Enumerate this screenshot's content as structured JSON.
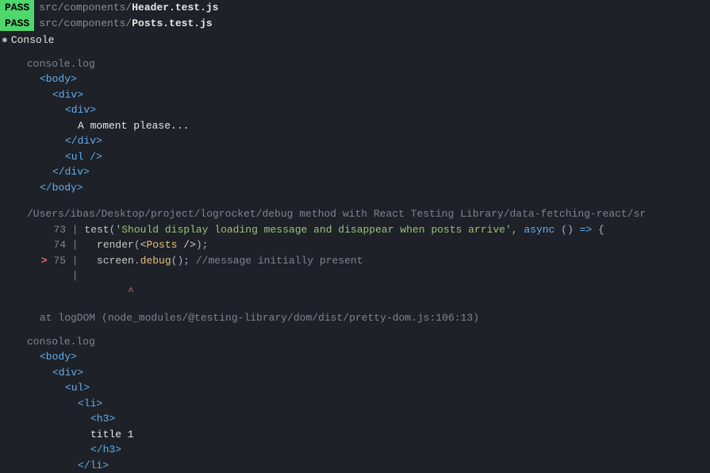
{
  "results": [
    {
      "badge": "PASS",
      "dir": "src/components/",
      "file": "Header.test.js"
    },
    {
      "badge": "PASS",
      "dir": "src/components/",
      "file": "Posts.test.js"
    }
  ],
  "console_label": "Console",
  "log1": {
    "label": "console.log",
    "lines": [
      {
        "cls": "indent-0 tag",
        "text": "<body>"
      },
      {
        "cls": "indent-1 tag",
        "text": "<div>"
      },
      {
        "cls": "indent-2 tag",
        "text": "<div>"
      },
      {
        "cls": "indent-3 text-white",
        "text": "A moment please..."
      },
      {
        "cls": "indent-2 tag",
        "text": "</div>"
      },
      {
        "cls": "indent-2 tag",
        "text": "<ul />"
      },
      {
        "cls": "indent-1 tag",
        "text": "</div>"
      },
      {
        "cls": "indent-0 tag",
        "text": "</body>"
      }
    ]
  },
  "source_path": "/Users/ibas/Desktop/project/logrocket/debug method with React Testing Library/data-fetching-react/sr",
  "code": {
    "line73": {
      "num": "   73 | ",
      "test": "test",
      "paren_open": "(",
      "str": "'Should display loading message and disappear when posts arrive'",
      "comma": ", ",
      "async": "async",
      "arrow": " () ",
      "fat": "=>",
      "brace": " {"
    },
    "line74": {
      "num": "   74 |   ",
      "render": "render",
      "open": "(",
      "lt": "<",
      "comp": "Posts",
      "close": " />",
      "paren_close": ");"
    },
    "line75": {
      "pointer": " > ",
      "num": "75 |   ",
      "screen": "screen",
      "dot": ".",
      "debug": "debug",
      "call": "();",
      "comment": " //message initially present"
    },
    "line_blank": {
      "num": "      |       "
    },
    "caret": "               ^"
  },
  "stack": "at logDOM (node_modules/@testing-library/dom/dist/pretty-dom.js:106:13)",
  "log2": {
    "label": "console.log",
    "lines": [
      {
        "cls": "indent-0 tag",
        "text": "<body>"
      },
      {
        "cls": "indent-1 tag",
        "text": "<div>"
      },
      {
        "cls": "indent-2 tag",
        "text": "<ul>"
      },
      {
        "cls": "indent-3 tag",
        "text": "<li>"
      },
      {
        "cls": "indent-4 tag",
        "text": "<h3>"
      },
      {
        "cls": "indent-4 text-white",
        "text": "  title 1"
      },
      {
        "cls": "indent-4 tag",
        "text": "</h3>"
      },
      {
        "cls": "indent-3 tag",
        "text": "</li>"
      }
    ]
  }
}
